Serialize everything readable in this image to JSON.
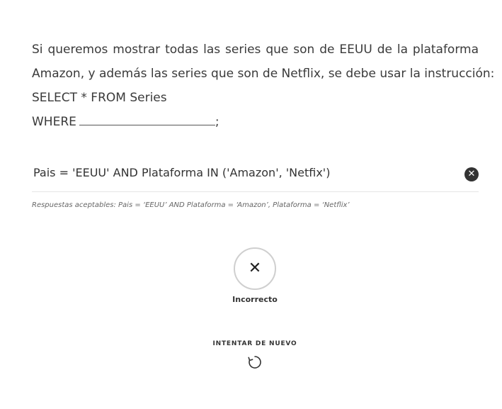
{
  "question": {
    "line1": "Si queremos mostrar todas las series que son de EEUU de la plataforma",
    "line2": "Amazon, y además las series que son de Netflix,  se debe usar la instrucción:",
    "line3": "SELECT * FROM Series",
    "line4_prefix": "WHERE",
    "line4_suffix": ";"
  },
  "answer": {
    "value": "Pais = 'EEUU' AND Plataforma IN ('Amazon', 'Netfix')",
    "status_icon": "close-icon"
  },
  "accepted_answers": "Respuestas aceptables: Pais = ‘EEUU’ AND Plataforma = ‘Amazon’, Plataforma = ‘Netflix’",
  "result": {
    "icon": "x-icon",
    "label": "Incorrecto"
  },
  "retry": {
    "label": "INTENTAR DE NUEVO",
    "icon": "refresh-icon"
  }
}
